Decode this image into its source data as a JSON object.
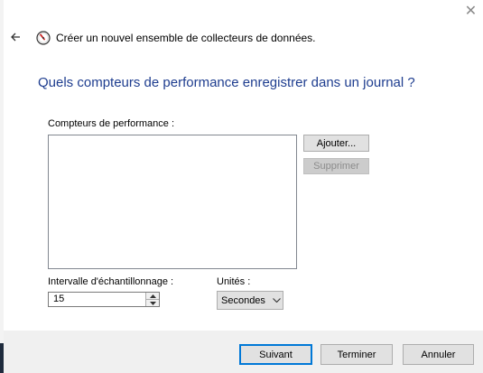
{
  "window": {
    "close_glyph": "✕"
  },
  "header": {
    "back_icon": "back-arrow-icon",
    "wizard_icon": "performance-monitor-icon",
    "wizard_title": "Créer un nouvel ensemble de collecteurs de données."
  },
  "main": {
    "heading": "Quels compteurs de performance enregistrer dans un journal ?",
    "counters_label": "Compteurs de performance :",
    "counters": [],
    "add_button": "Ajouter...",
    "remove_button": "Supprimer",
    "interval_label": "Intervalle d'échantillonnage :",
    "interval_value": "15",
    "units_label": "Unités :",
    "units_value": "Secondes"
  },
  "footer": {
    "next_button": "Suivant",
    "finish_button": "Terminer",
    "cancel_button": "Annuler"
  },
  "colors": {
    "heading": "#1e3d8f",
    "default_button_border": "#0078d7",
    "footer_bg": "#f0f0f0"
  }
}
